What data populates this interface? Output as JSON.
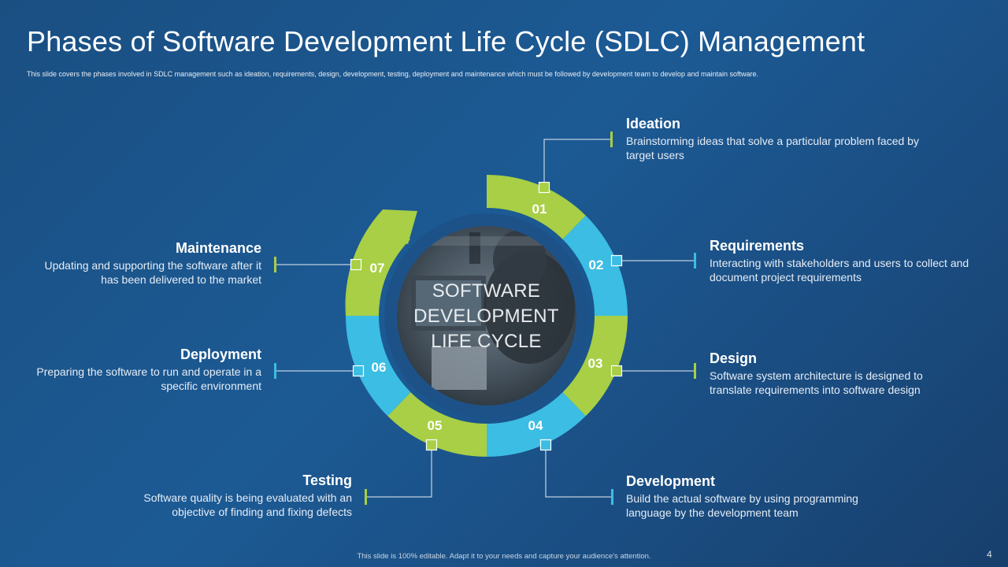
{
  "header": {
    "title": "Phases of Software Development Life Cycle (SDLC) Management",
    "subtitle": "This slide covers the phases involved in SDLC management  such as ideation,  requirements, design, development, testing, deployment and maintenance which must be followed by development team to develop and maintain  software."
  },
  "center": {
    "line1": "SOFTWARE",
    "line2": "DEVELOPMENT",
    "line3": "LIFE CYCLE"
  },
  "phases": [
    {
      "num": "01",
      "title": "Ideation",
      "desc": "Brainstorming ideas that solve a particular problem faced by target users"
    },
    {
      "num": "02",
      "title": "Requirements",
      "desc": "Interacting with stakeholders and users to collect and document project requirements"
    },
    {
      "num": "03",
      "title": "Design",
      "desc": "Software system architecture is designed to translate requirements into software design"
    },
    {
      "num": "04",
      "title": "Development",
      "desc": "Build the actual software by using programming language by the development team"
    },
    {
      "num": "05",
      "title": "Testing",
      "desc": "Software quality is being evaluated with an objective of finding and fixing defects"
    },
    {
      "num": "06",
      "title": "Deployment",
      "desc": "Preparing the software to run and operate in a specific environment"
    },
    {
      "num": "07",
      "title": "Maintenance",
      "desc": "Updating and supporting the software after it has been delivered to the market"
    }
  ],
  "footer": {
    "note": "This slide is 100% editable.  Adapt it to your needs and capture your audience's attention.",
    "page": "4"
  },
  "colors": {
    "green": "#a8cf45",
    "cyan": "#3cbde3",
    "background": "#1c5a94"
  }
}
